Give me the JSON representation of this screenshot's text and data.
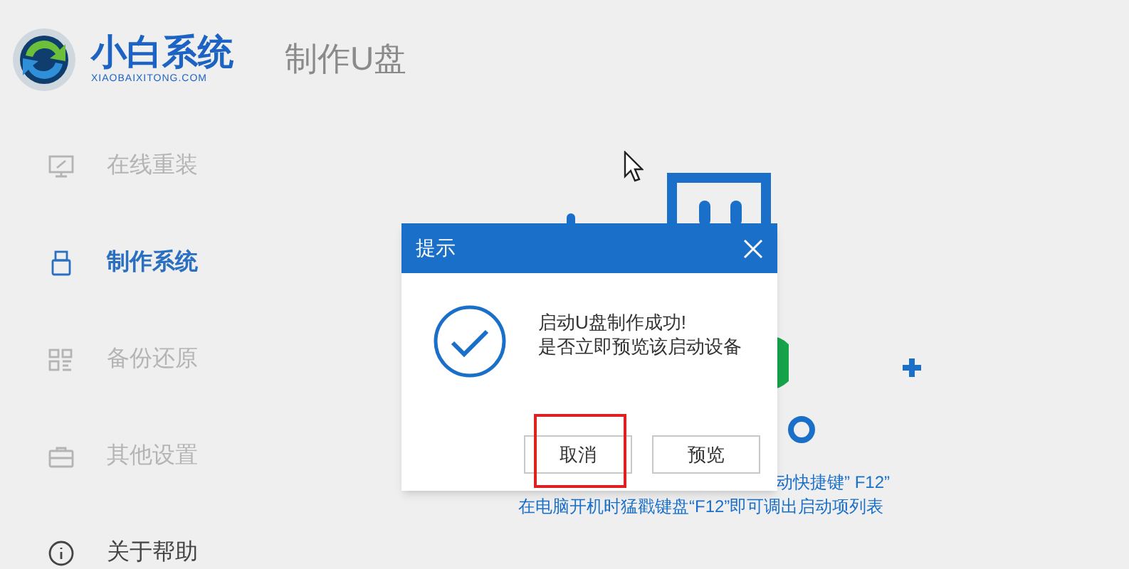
{
  "logo": {
    "name": "小白系统",
    "domain": "XIAOBAIXITONG.COM"
  },
  "page_title": "制作U盘",
  "sidebar": {
    "items": [
      {
        "kind": "monitor",
        "label": "在线重装",
        "selected": false,
        "dimmed": true
      },
      {
        "kind": "usb",
        "label": "制作系统",
        "selected": true,
        "dimmed": false
      },
      {
        "kind": "grid",
        "label": "备份还原",
        "selected": false,
        "dimmed": true
      },
      {
        "kind": "briefcase",
        "label": "其他设置",
        "selected": false,
        "dimmed": true
      },
      {
        "kind": "info",
        "label": "关于帮助",
        "selected": false,
        "dimmed": false
      }
    ]
  },
  "hints": [
    "动快捷键” F12”",
    "在电脑开机时猛戳键盘“F12”即可调出启动项列表"
  ],
  "dialog": {
    "title": "提示",
    "message": [
      "启动U盘制作成功!",
      "是否立即预览该启动设备"
    ],
    "buttons": [
      {
        "label": "取消",
        "annotated": true
      },
      {
        "label": "预览",
        "annotated": false
      }
    ]
  }
}
